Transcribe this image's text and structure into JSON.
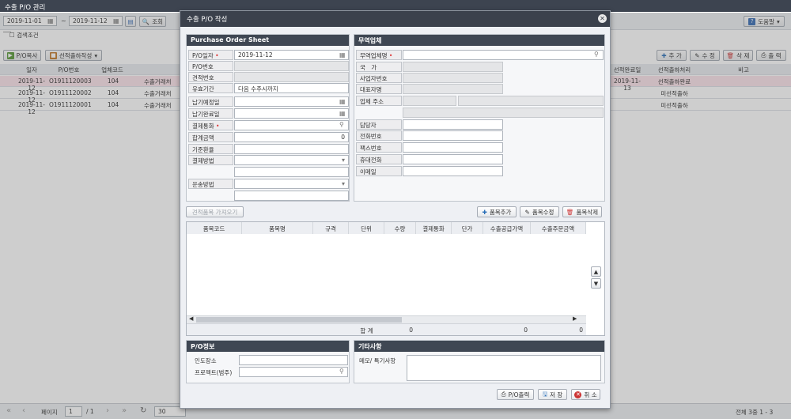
{
  "window": {
    "title": "수출 P/O 관리"
  },
  "background": {
    "date_from": "2019-11-01",
    "date_to": "2019-11-12",
    "search_btn": "조회",
    "search_cond": "검색조건",
    "help": "도움말",
    "po_copy": "P/O복사",
    "select_ship": "선적출하작성",
    "add": "추 가",
    "edit": "수 정",
    "delete": "삭 제",
    "print": "출 력",
    "headers": [
      "일자",
      "P/O번호",
      "업체코드",
      "",
      "",
      "선적완료일",
      "선적출하처리",
      "비고"
    ],
    "rows": [
      {
        "date": "2019-11-12",
        "po": "O1911120003",
        "code": "104",
        "name": "수출거래처",
        "ship_date": "2019-11-13",
        "status": "선적출하완료"
      },
      {
        "date": "2019-11-12",
        "po": "O1911120002",
        "code": "104",
        "name": "수출거래처",
        "ship_date": "",
        "status": "미선적출하"
      },
      {
        "date": "2019-11-12",
        "po": "O1911120001",
        "code": "104",
        "name": "수출거래처",
        "ship_date": "",
        "status": "미선적출하"
      }
    ],
    "pager": {
      "page_label": "페이지",
      "page": "1",
      "total_pages": "/ 1",
      "page_size": "30",
      "summary": "전체 3중 1 - 3"
    }
  },
  "modal": {
    "title": "수출 P/O 작성",
    "po_sheet": {
      "title": "Purchase Order Sheet",
      "po_date_label": "P/O일자",
      "po_date": "2019-11-12",
      "po_no_label": "P/O번호",
      "quote_no_label": "견적번호",
      "validity_label": "유효기간",
      "validity": "다음 수주시까지",
      "due_label": "납기예정일",
      "done_label": "납기완료일",
      "currency_label": "결제통화",
      "total_label": "합계금액",
      "total": "0",
      "rate_label": "기준환율",
      "pay_label": "결제방법",
      "ship_label": "운송방법"
    },
    "vendor": {
      "title": "무역업체",
      "name_label": "무역업체명",
      "country_label": "국　가",
      "biz_label": "사업자번호",
      "ceo_label": "대표자명",
      "addr_label": "업체 주소",
      "contact_label": "담당자",
      "tel_label": "전화번호",
      "fax_label": "팩스번호",
      "mobile_label": "휴대전화",
      "email_label": "이메일"
    },
    "items": {
      "import_btn": "견적품목 가져오기",
      "add_btn": "품목추가",
      "edit_btn": "품목수정",
      "del_btn": "품목삭제",
      "headers": [
        "품목코드",
        "품목명",
        "규격",
        "단위",
        "수량",
        "결제통화",
        "단가",
        "수출공급가액",
        "수출주문금액"
      ],
      "sum_label": "합 계",
      "sum_qty": "0",
      "sum_supply": "0",
      "sum_order": "0"
    },
    "po_info": {
      "title": "P/O정보",
      "delivery_label": "인도장소",
      "project_label": "프로젝트(범주)"
    },
    "etc": {
      "title": "기타사항",
      "memo_label": "메모/ 특기사항"
    },
    "footer": {
      "print": "P/O출력",
      "save": "저 장",
      "cancel": "취 소"
    }
  }
}
